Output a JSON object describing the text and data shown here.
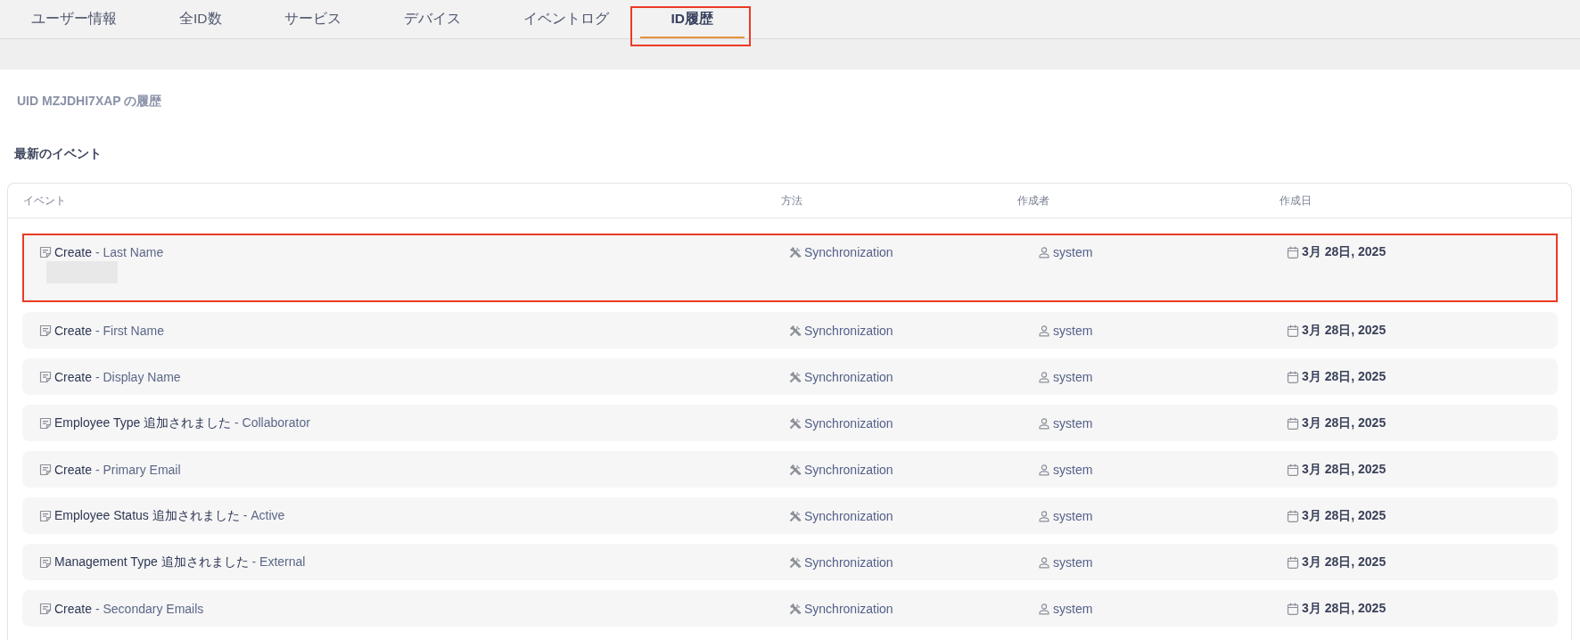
{
  "tabs": [
    {
      "label": "ユーザー情報",
      "selected": false,
      "highlighted": false
    },
    {
      "label": "全ID数",
      "selected": false,
      "highlighted": false
    },
    {
      "label": "サービス",
      "selected": false,
      "highlighted": false
    },
    {
      "label": "デバイス",
      "selected": false,
      "highlighted": false
    },
    {
      "label": "イベントログ",
      "selected": false,
      "highlighted": false
    },
    {
      "label": "ID履歴",
      "selected": true,
      "highlighted": true
    }
  ],
  "page": {
    "subtitle": "UID MZJDHI7XAP の履歴",
    "section_title": "最新のイベント"
  },
  "table": {
    "columns": [
      "イベント",
      "方法",
      "作成者",
      "作成日"
    ],
    "rows": [
      {
        "action": "Create",
        "detail": "- Last Name",
        "method": "Synchronization",
        "creator": "system",
        "date": "3月 28日, 2025",
        "expanded": true,
        "highlighted": true
      },
      {
        "action": "Create",
        "detail": "- First Name",
        "method": "Synchronization",
        "creator": "system",
        "date": "3月 28日, 2025",
        "expanded": false,
        "highlighted": false
      },
      {
        "action": "Create",
        "detail": "- Display Name",
        "method": "Synchronization",
        "creator": "system",
        "date": "3月 28日, 2025",
        "expanded": false,
        "highlighted": false
      },
      {
        "action": "Employee Type 追加されました",
        "detail": "- Collaborator",
        "method": "Synchronization",
        "creator": "system",
        "date": "3月 28日, 2025",
        "expanded": false,
        "highlighted": false
      },
      {
        "action": "Create",
        "detail": "- Primary Email",
        "method": "Synchronization",
        "creator": "system",
        "date": "3月 28日, 2025",
        "expanded": false,
        "highlighted": false
      },
      {
        "action": "Employee Status 追加されました",
        "detail": "- Active",
        "method": "Synchronization",
        "creator": "system",
        "date": "3月 28日, 2025",
        "expanded": false,
        "highlighted": false
      },
      {
        "action": "Management Type 追加されました",
        "detail": "- External",
        "method": "Synchronization",
        "creator": "system",
        "date": "3月 28日, 2025",
        "expanded": false,
        "highlighted": false
      },
      {
        "action": "Create",
        "detail": "- Secondary Emails",
        "method": "Synchronization",
        "creator": "system",
        "date": "3月 28日, 2025",
        "expanded": false,
        "highlighted": false
      }
    ]
  }
}
